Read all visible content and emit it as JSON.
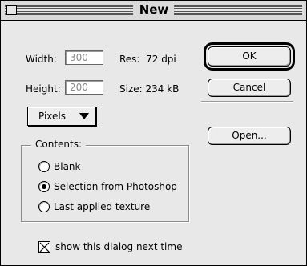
{
  "window": {
    "title": "New"
  },
  "width": {
    "label": "Width:",
    "value": "300"
  },
  "height": {
    "label": "Height:",
    "value": "200"
  },
  "res": {
    "text": "Res:  72 dpi"
  },
  "size": {
    "text": "Size: 234 kB"
  },
  "units": {
    "selected": "Pixels"
  },
  "contents": {
    "title": "Contents:",
    "options": [
      {
        "label": "Blank",
        "selected": false
      },
      {
        "label": "Selection from Photoshop",
        "selected": true
      },
      {
        "label": "Last applied texture",
        "selected": false
      }
    ]
  },
  "checkbox": {
    "label": "show this dialog next time",
    "checked": true
  },
  "buttons": {
    "ok": "OK",
    "cancel": "Cancel",
    "open": "Open..."
  }
}
